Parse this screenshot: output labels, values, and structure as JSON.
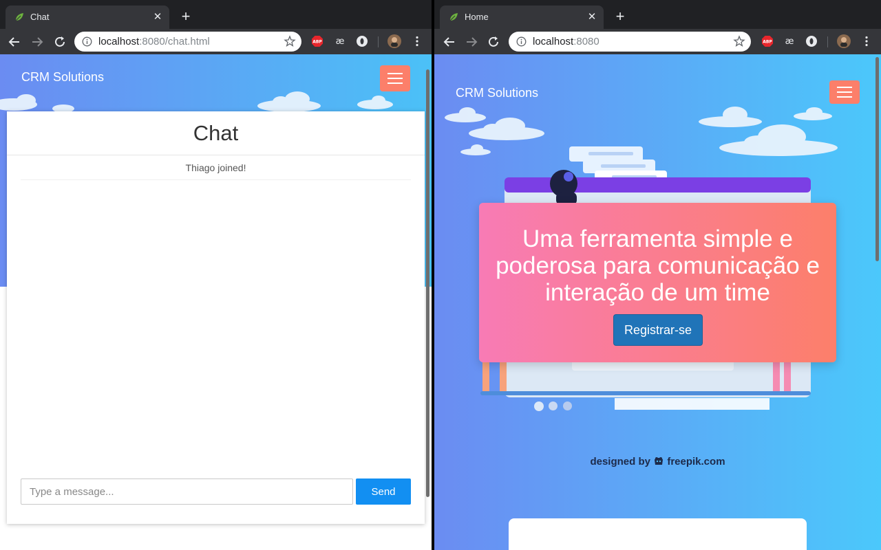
{
  "left_window": {
    "tab": {
      "title": "Chat",
      "close_icon": "close-icon",
      "favicon": "spring-leaf-icon"
    },
    "newtab_icon": "plus-icon",
    "address": {
      "host": "localhost",
      "port_path": ":8080/chat.html"
    },
    "page": {
      "brand": "CRM Solutions",
      "chat_title": "Chat",
      "messages": [
        {
          "text": "Thiago joined!"
        }
      ],
      "input": {
        "placeholder": "Type a message...",
        "value": ""
      },
      "send_label": "Send"
    }
  },
  "right_window": {
    "tab": {
      "title": "Home",
      "close_icon": "close-icon",
      "favicon": "spring-leaf-icon"
    },
    "newtab_icon": "plus-icon",
    "address": {
      "host": "localhost",
      "port_path": ":8080"
    },
    "page": {
      "brand": "CRM Solutions",
      "headline": "Uma ferramenta simple e poderosa para comunicação e interação de um time",
      "register_label": "Registrar-se",
      "credit_prefix": "designed by",
      "credit_brand": "freepik.com",
      "carousel_dots": 3
    }
  },
  "colors": {
    "tab_bg": "#35363a",
    "tabstrip_bg": "#202124",
    "hero_start": "#6b8cf2",
    "hero_end": "#4bc1f7",
    "hamburger": "#fc7f6a",
    "send_button": "#128ff2",
    "register_button": "#2074b8",
    "card_start": "#f87bb5",
    "card_end": "#fc7f6a"
  }
}
